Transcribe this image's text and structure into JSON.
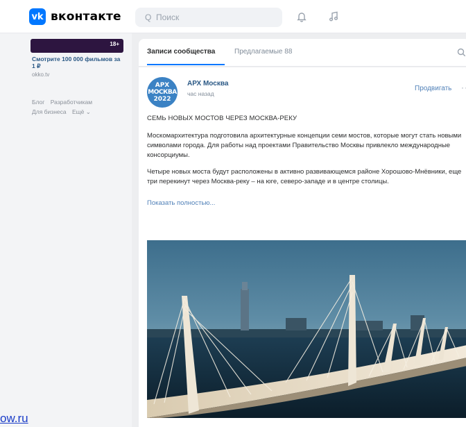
{
  "app": {
    "logo_glyph": "vk",
    "logo_text": "вконтакте"
  },
  "header": {
    "search_placeholder": "Q  Поиск",
    "icons": [
      "bell-icon",
      "music-note-icon"
    ]
  },
  "sidebar": {
    "promo": {
      "age_badge": "18+",
      "title": "Смотрите 100 000 фильмов за 1 ₽",
      "domain": "okko.tv"
    },
    "footer_links": [
      "Блог",
      "Разработчикам",
      "Для бизнеса",
      "Ещё ⌄"
    ]
  },
  "feed": {
    "tabs": [
      {
        "label": "Записи сообщества",
        "active": true
      },
      {
        "label": "Предлагаемые 88",
        "active": false
      }
    ]
  },
  "post": {
    "avatar_lines": [
      "АРХ",
      "МОСКВА",
      "2022"
    ],
    "author": "АРХ Москва",
    "time": "час назад",
    "promote_label": "Продвигать",
    "more_label": "···",
    "title": "СЕМЬ НОВЫХ МОСТОВ ЧЕРЕЗ МОСКВА-РЕКУ",
    "paragraph_1": "Москомархитектура подготовила архитектурные концепции семи мостов, которые могут стать новыми символами города. Для работы над проектами Правительство Москвы привлекло международные консорциумы.",
    "paragraph_2": "Четыре новых моста будут расположены в активно развивающемся районе Хорошово-Мнёвники, еще три перекинут через Москва-реку – на юге, северо-западе и в центре столицы.",
    "show_more": "Показать полностью..."
  },
  "watermark": "ow.ru",
  "colors": {
    "accent": "#0077ff",
    "link": "#2a5885",
    "page_bg": "#edeef0"
  }
}
